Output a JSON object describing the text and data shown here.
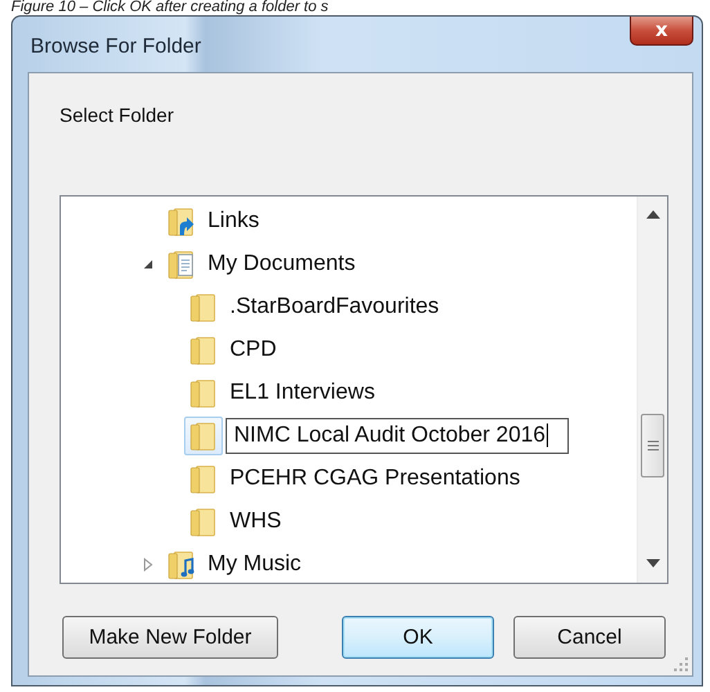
{
  "caption": "Figure 10 – Click OK after creating a folder to s",
  "window": {
    "title": "Browse For Folder",
    "close": "x"
  },
  "prompt": "Select Folder",
  "tree": {
    "items": [
      {
        "label": "Links",
        "kind": "link-folder",
        "selected": false,
        "editing": false
      },
      {
        "label": "My Documents",
        "kind": "documents",
        "expanded": true,
        "selected": false,
        "editing": false,
        "children": [
          {
            "label": ".StarBoardFavourites",
            "kind": "folder",
            "selected": false,
            "editing": false
          },
          {
            "label": "CPD",
            "kind": "folder",
            "selected": false,
            "editing": false
          },
          {
            "label": "EL1 Interviews",
            "kind": "folder",
            "selected": false,
            "editing": false
          },
          {
            "label": "NIMC Local Audit October 2016",
            "kind": "folder",
            "selected": true,
            "editing": true
          },
          {
            "label": "PCEHR CGAG Presentations",
            "kind": "folder",
            "selected": false,
            "editing": false
          },
          {
            "label": "WHS",
            "kind": "folder",
            "selected": false,
            "editing": false
          }
        ]
      },
      {
        "label": "My Music",
        "kind": "music",
        "expanded": false,
        "selected": false,
        "editing": false
      }
    ]
  },
  "buttons": [
    {
      "label": "Make New Folder",
      "default": false
    },
    {
      "label": "OK",
      "default": true
    },
    {
      "label": "Cancel",
      "default": false
    }
  ]
}
